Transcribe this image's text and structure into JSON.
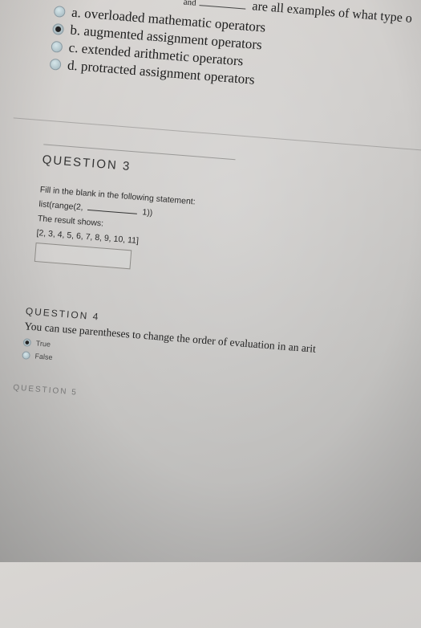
{
  "q2": {
    "stem_prefix": "and",
    "stem": "are all examples of what type o",
    "options": [
      {
        "label": "a. overloaded mathematic operators",
        "selected": false
      },
      {
        "label": "b. augmented assignment operators",
        "selected": true
      },
      {
        "label": "c. extended arithmetic operators",
        "selected": false
      },
      {
        "label": "d. protracted assignment operators",
        "selected": false
      }
    ]
  },
  "q3": {
    "title": "QUESTION 3",
    "instruction": "Fill in the blank in the following statement:",
    "code_before": "list(range(2,",
    "code_after": "1))",
    "result_label": "The result shows:",
    "result_value": "[2, 3, 4, 5, 6, 7, 8, 9, 10, 11]",
    "answer_value": ""
  },
  "q4": {
    "title": "QUESTION 4",
    "question": "You can use parentheses to change the order of evaluation in an arit",
    "options": [
      {
        "label": "True",
        "selected": true
      },
      {
        "label": "False",
        "selected": false
      }
    ]
  },
  "q5": {
    "title": "QUESTION 5"
  }
}
